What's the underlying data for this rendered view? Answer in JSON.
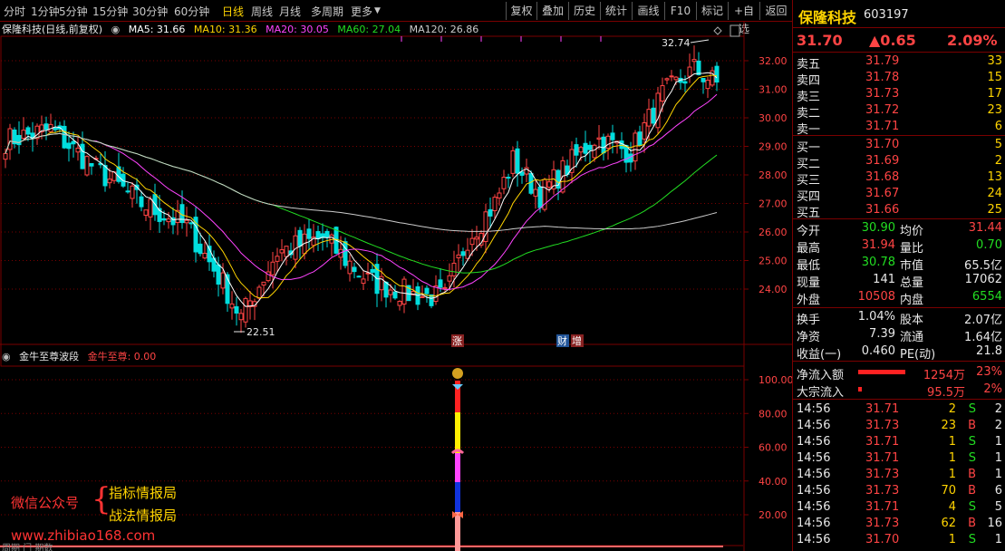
{
  "toolbar": {
    "periods": [
      "分时",
      "1分钟",
      "5分钟",
      "15分钟",
      "30分钟",
      "60分钟",
      "日线",
      "周线",
      "月线",
      "多周期",
      "更多"
    ],
    "active_period": "日线",
    "buttons": [
      "复权",
      "叠加",
      "历史",
      "统计",
      "画线",
      "F10",
      "标记",
      "+自选",
      "返回"
    ]
  },
  "info_line": {
    "name": "保隆科技(日线,前复权)",
    "ma5": "MA5: 31.66",
    "ma10": "MA10: 31.36",
    "ma20": "MA20: 30.05",
    "ma60": "MA60: 27.04",
    "ma120": "MA120: 26.86"
  },
  "price_axis": [
    "32.00",
    "31.00",
    "30.00",
    "29.00",
    "28.00",
    "27.00",
    "26.00",
    "25.00",
    "24.00"
  ],
  "indicator": {
    "name": "金牛至尊波段",
    "value": "金牛至尊: 0.00",
    "axis": [
      "100.00",
      "80.00",
      "60.00",
      "40.00",
      "20.00"
    ]
  },
  "annotations": {
    "high_label": "32.74",
    "low_label": "22.51",
    "event_zhang": "涨",
    "event_cai": "财",
    "event_zeng": "增"
  },
  "watermark": {
    "wechat": "微信公众号",
    "brace": "{",
    "line1": "指标情报局",
    "line2": "战法情报局",
    "site": "www.zhibiao168.com",
    "corner": "周期 门 期数"
  },
  "colors": {
    "up": "#ff4444",
    "down": "#00dede",
    "ma5": "#ffffff",
    "ma10": "#ffd400",
    "ma20": "#ff44ff",
    "ma60": "#22dd22",
    "ma120": "#cccccc",
    "grid": "#7a0000"
  },
  "quote": {
    "name": "保隆科技",
    "code": "603197",
    "price": "31.70",
    "change": "▲0.65",
    "pct": "2.09%"
  },
  "order_book": {
    "asks": [
      {
        "label": "卖五",
        "price": "31.79",
        "vol": "33"
      },
      {
        "label": "卖四",
        "price": "31.78",
        "vol": "15"
      },
      {
        "label": "卖三",
        "price": "31.73",
        "vol": "17"
      },
      {
        "label": "卖二",
        "price": "31.72",
        "vol": "23"
      },
      {
        "label": "卖一",
        "price": "31.71",
        "vol": "6"
      }
    ],
    "bids": [
      {
        "label": "买一",
        "price": "31.70",
        "vol": "5"
      },
      {
        "label": "买二",
        "price": "31.69",
        "vol": "2"
      },
      {
        "label": "买三",
        "price": "31.68",
        "vol": "13"
      },
      {
        "label": "买四",
        "price": "31.67",
        "vol": "24"
      },
      {
        "label": "买五",
        "price": "31.66",
        "vol": "25"
      }
    ]
  },
  "stats1": [
    {
      "l1": "今开",
      "v1": "30.90",
      "c1": "grn",
      "l2": "均价",
      "v2": "31.44",
      "c2": "red"
    },
    {
      "l1": "最高",
      "v1": "31.94",
      "c1": "red",
      "l2": "量比",
      "v2": "0.70",
      "c2": "grn"
    },
    {
      "l1": "最低",
      "v1": "30.78",
      "c1": "grn",
      "l2": "市值",
      "v2": "65.5亿",
      "c2": "wht"
    },
    {
      "l1": "现量",
      "v1": "141",
      "c1": "wht",
      "l2": "总量",
      "v2": "17062",
      "c2": "wht"
    },
    {
      "l1": "外盘",
      "v1": "10508",
      "c1": "red",
      "l2": "内盘",
      "v2": "6554",
      "c2": "grn"
    }
  ],
  "stats2": [
    {
      "l1": "换手",
      "v1": "1.04%",
      "l2": "股本",
      "v2": "2.07亿"
    },
    {
      "l1": "净资",
      "v1": "7.39",
      "l2": "流通",
      "v2": "1.64亿"
    },
    {
      "l1": "收益(一)",
      "v1": "0.460",
      "l2": "PE(动)",
      "v2": "21.8"
    }
  ],
  "flows": [
    {
      "label": "净流入额",
      "value": "1254万",
      "pct": "23%",
      "bar": 0.58
    },
    {
      "label": "大宗流入",
      "value": "95.5万",
      "pct": "2%",
      "bar": 0.04
    }
  ],
  "ticks": [
    {
      "time": "14:56",
      "price": "31.71",
      "vol": "2",
      "side": "S",
      "n": "2"
    },
    {
      "time": "14:56",
      "price": "31.73",
      "vol": "23",
      "side": "B",
      "n": "2"
    },
    {
      "time": "14:56",
      "price": "31.71",
      "vol": "1",
      "side": "S",
      "n": "1"
    },
    {
      "time": "14:56",
      "price": "31.71",
      "vol": "1",
      "side": "S",
      "n": "1"
    },
    {
      "time": "14:56",
      "price": "31.73",
      "vol": "1",
      "side": "B",
      "n": "1"
    },
    {
      "time": "14:56",
      "price": "31.73",
      "vol": "70",
      "side": "B",
      "n": "6"
    },
    {
      "time": "14:56",
      "price": "31.71",
      "vol": "4",
      "side": "S",
      "n": "5"
    },
    {
      "time": "14:56",
      "price": "31.73",
      "vol": "62",
      "side": "B",
      "n": "16"
    },
    {
      "time": "14:56",
      "price": "31.70",
      "vol": "1",
      "side": "S",
      "n": "1"
    }
  ]
}
